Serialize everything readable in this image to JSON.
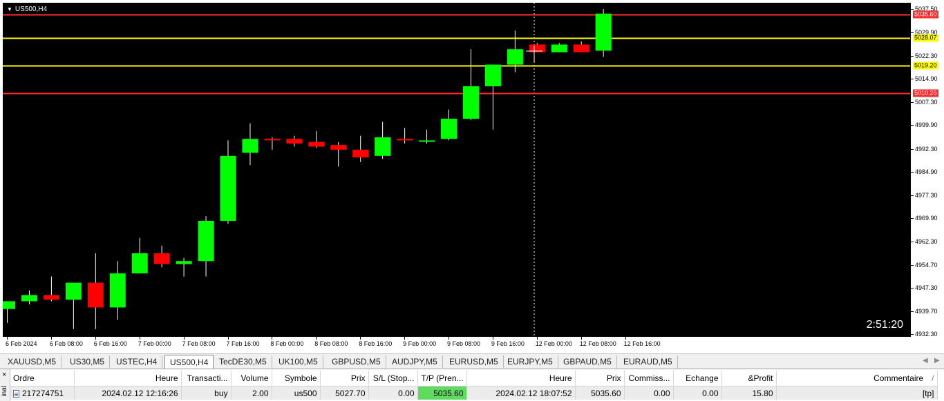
{
  "chart": {
    "title": "US500,H4",
    "countdown": "2:51:20",
    "price_ticks": [
      "5037.50",
      "5029.90",
      "5022.30",
      "5014.90",
      "5007.30",
      "4999.90",
      "4992.30",
      "4984.90",
      "4977.30",
      "4969.90",
      "4962.30",
      "4954.70",
      "4947.30",
      "4939.70",
      "4932.30"
    ],
    "time_labels": [
      "6 Feb 2024",
      "6 Feb 08:00",
      "6 Feb 16:00",
      "7 Feb 00:00",
      "7 Feb 08:00",
      "7 Feb 16:00",
      "8 Feb 00:00",
      "8 Feb 08:00",
      "8 Feb 16:00",
      "9 Feb 00:00",
      "9 Feb 08:00",
      "9 Feb 16:00",
      "12 Feb 00:00",
      "12 Feb 08:00",
      "12 Feb 16:00"
    ],
    "levels": [
      {
        "price": 5035.6,
        "label": "5035.60",
        "color": "#ff2a2a",
        "text_color": "#ffffff"
      },
      {
        "price": 5028.07,
        "label": "5028.07",
        "color": "#ffff00",
        "text_color": "#000000"
      },
      {
        "price": 5019.2,
        "label": "5019.20",
        "color": "#ffff00",
        "text_color": "#000000"
      },
      {
        "price": 5010.26,
        "label": "5010.26",
        "color": "#ff2a2a",
        "text_color": "#ffffff"
      }
    ],
    "colors": {
      "bull": "#00ff00",
      "bear": "#ff0000",
      "wick": "#ffffff",
      "background": "#000000"
    }
  },
  "chart_data": {
    "type": "candlestick",
    "symbol": "US500",
    "timeframe": "H4",
    "y_range": [
      4931.5,
      5039.5
    ],
    "candles": [
      {
        "o": 4940.5,
        "h": 4943.0,
        "l": 4936.0,
        "c": 4943.0
      },
      {
        "o": 4943.0,
        "h": 4946.5,
        "l": 4942.0,
        "c": 4945.0
      },
      {
        "o": 4945.0,
        "h": 4951.0,
        "l": 4943.0,
        "c": 4943.5
      },
      {
        "o": 4943.5,
        "h": 4949.0,
        "l": 4934.0,
        "c": 4949.0
      },
      {
        "o": 4949.0,
        "h": 4958.5,
        "l": 4934.0,
        "c": 4941.0
      },
      {
        "o": 4941.0,
        "h": 4956.0,
        "l": 4937.0,
        "c": 4952.0
      },
      {
        "o": 4952.0,
        "h": 4963.5,
        "l": 4952.0,
        "c": 4958.5
      },
      {
        "o": 4958.5,
        "h": 4961.0,
        "l": 4954.0,
        "c": 4955.0
      },
      {
        "o": 4955.0,
        "h": 4957.0,
        "l": 4951.0,
        "c": 4956.0
      },
      {
        "o": 4956.0,
        "h": 4970.5,
        "l": 4951.0,
        "c": 4969.0
      },
      {
        "o": 4969.0,
        "h": 4995.0,
        "l": 4968.0,
        "c": 4990.0
      },
      {
        "o": 4991.0,
        "h": 5000.5,
        "l": 4987.0,
        "c": 4995.5
      },
      {
        "o": 4995.5,
        "h": 4996.0,
        "l": 4992.0,
        "c": 4995.0
      },
      {
        "o": 4995.5,
        "h": 4996.5,
        "l": 4993.0,
        "c": 4994.0
      },
      {
        "o": 4994.5,
        "h": 4998.0,
        "l": 4992.5,
        "c": 4993.0
      },
      {
        "o": 4993.5,
        "h": 4994.5,
        "l": 4986.5,
        "c": 4992.0
      },
      {
        "o": 4992.0,
        "h": 4996.5,
        "l": 4988.0,
        "c": 4989.5
      },
      {
        "o": 4990.0,
        "h": 5001.0,
        "l": 4989.0,
        "c": 4996.0
      },
      {
        "o": 4995.5,
        "h": 4999.0,
        "l": 4994.0,
        "c": 4995.0
      },
      {
        "o": 4995.0,
        "h": 4998.5,
        "l": 4994.0,
        "c": 4995.0
      },
      {
        "o": 4995.5,
        "h": 5005.0,
        "l": 4995.0,
        "c": 5002.0
      },
      {
        "o": 5002.0,
        "h": 5024.5,
        "l": 5001.5,
        "c": 5012.5
      },
      {
        "o": 5012.5,
        "h": 5019.5,
        "l": 4998.5,
        "c": 5019.5
      },
      {
        "o": 5019.5,
        "h": 5030.5,
        "l": 5017.0,
        "c": 5024.5
      },
      {
        "o": 5026.0,
        "h": 5026.5,
        "l": 5023.5,
        "c": 5023.5
      },
      {
        "o": 5023.5,
        "h": 5026.5,
        "l": 5023.5,
        "c": 5026.0
      },
      {
        "o": 5026.0,
        "h": 5027.0,
        "l": 5023.5,
        "c": 5023.5
      },
      {
        "o": 5024.0,
        "h": 5037.5,
        "l": 5022.0,
        "c": 5036.0
      }
    ]
  },
  "tabs": [
    {
      "label": "XAUUSD,M5",
      "active": false
    },
    {
      "label": "US30,M5",
      "active": false
    },
    {
      "label": "USTEC,H4",
      "active": false
    },
    {
      "label": "US500,H4",
      "active": true
    },
    {
      "label": "TecDE30,M5",
      "active": false
    },
    {
      "label": "UK100,M5",
      "active": false
    },
    {
      "label": "GBPUSD,M5",
      "active": false
    },
    {
      "label": "AUDJPY,M5",
      "active": false
    },
    {
      "label": "EURUSD,M5",
      "active": false
    },
    {
      "label": "EURJPY,M5",
      "active": false
    },
    {
      "label": "GBPAUD,M5",
      "active": false
    },
    {
      "label": "EURAUD,M5",
      "active": false
    }
  ],
  "terminal": {
    "side_label": "inal",
    "close_glyph": "×",
    "headers": [
      "Ordre",
      "Heure",
      "Transacti...",
      "Volume",
      "Symbole",
      "Prix",
      "S/L (Stop...",
      "T/P (Pren...",
      "Heure",
      "Prix",
      "Commiss...",
      "Echange",
      "&Profit",
      "Commentaire"
    ],
    "sort_indicator": "/",
    "row": [
      "217274751",
      "2024.02.12 12:16:26",
      "buy",
      "2.00",
      "us500",
      "5027.70",
      "0.00",
      "5035.60",
      "2024.02.12 18:07:52",
      "5035.60",
      "0.00",
      "0.00",
      "15.80",
      "[tp]"
    ]
  }
}
